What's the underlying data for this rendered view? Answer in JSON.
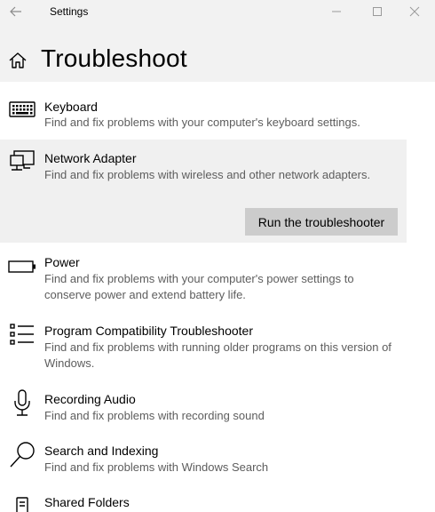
{
  "window": {
    "app_title": "Settings"
  },
  "header": {
    "page_title": "Troubleshoot"
  },
  "items": [
    {
      "name": "Keyboard",
      "description": "Find and fix problems with your computer's keyboard settings.",
      "icon": "keyboard-icon"
    },
    {
      "name": "Network Adapter",
      "description": "Find and fix problems with wireless and other network adapters.",
      "icon": "network-adapter-icon",
      "selected": true
    },
    {
      "name": "Power",
      "description": "Find and fix problems with your computer's power settings to conserve power and extend battery life.",
      "icon": "battery-icon"
    },
    {
      "name": "Program Compatibility Troubleshooter",
      "description": "Find and fix problems with running older programs on this version of Windows.",
      "icon": "list-icon"
    },
    {
      "name": "Recording Audio",
      "description": "Find and fix problems with recording sound",
      "icon": "microphone-icon"
    },
    {
      "name": "Search and Indexing",
      "description": "Find and fix problems with Windows Search",
      "icon": "search-icon"
    },
    {
      "name": "Shared Folders",
      "description": "",
      "icon": "shared-folders-icon"
    }
  ],
  "run_button": {
    "label": "Run the troubleshooter"
  },
  "colors": {
    "titlebar_bg": "#f2f2f2",
    "selected_bg": "#f0f0f0",
    "button_bg": "#cccccc",
    "description_text": "#5d5d5d"
  }
}
